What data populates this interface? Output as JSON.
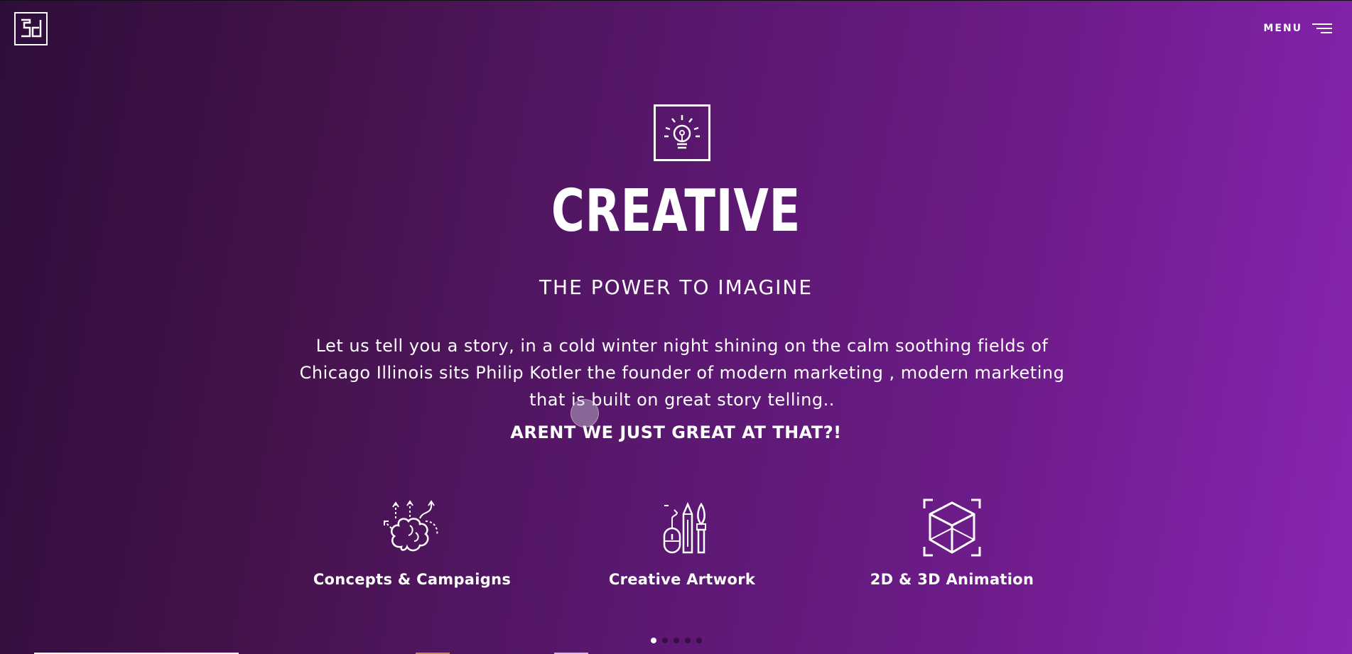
{
  "header": {
    "logo_icon": "5d-logo-icon",
    "menu_label": "MENU",
    "menu_icon": "hamburger-icon"
  },
  "hero": {
    "top_icon": "lightbulb-icon",
    "headline": "CREATIVE",
    "subheadline": "THE POWER TO IMAGINE",
    "story": "Let us tell you a story, in a cold winter night shining on the calm soothing fields of Chicago Illinois sits Philip Kotler the founder of modern marketing , modern marketing that is built on great story telling..",
    "tagline": "ARENT WE JUST GREAT AT THAT?!"
  },
  "services": [
    {
      "label": "Concepts & Campaigns",
      "icon": "brain-ideas-icon"
    },
    {
      "label": "Creative Artwork",
      "icon": "art-tools-icon"
    },
    {
      "label": "2D & 3D Animation",
      "icon": "3d-cube-icon"
    }
  ],
  "pagination": {
    "count": 5,
    "active_index": 0
  },
  "colors": {
    "gradient_start": "#2e0d3c",
    "gradient_end": "#8a25b4",
    "text": "#ffffff"
  }
}
